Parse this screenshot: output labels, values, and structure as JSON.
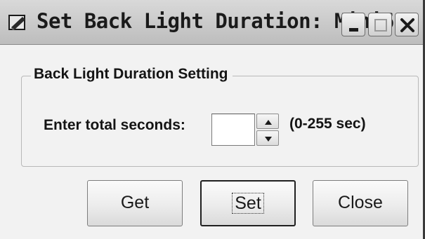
{
  "window": {
    "title": "Set Back Light Duration: Mini600",
    "icon": "app-pencil-icon",
    "controls": {
      "minimize": "minimize-icon",
      "maximize": "maximize-icon",
      "close": "close-icon"
    }
  },
  "group": {
    "title": "Back Light Duration Setting",
    "field_label": "Enter total seconds:",
    "seconds_value": "",
    "range_text": "(0-255 sec)"
  },
  "buttons": {
    "get": "Get",
    "set": "Set",
    "close": "Close"
  },
  "colors": {
    "window_bg": "#f2f2f2",
    "titlebar": "#c8c8c8",
    "text": "#141414"
  }
}
